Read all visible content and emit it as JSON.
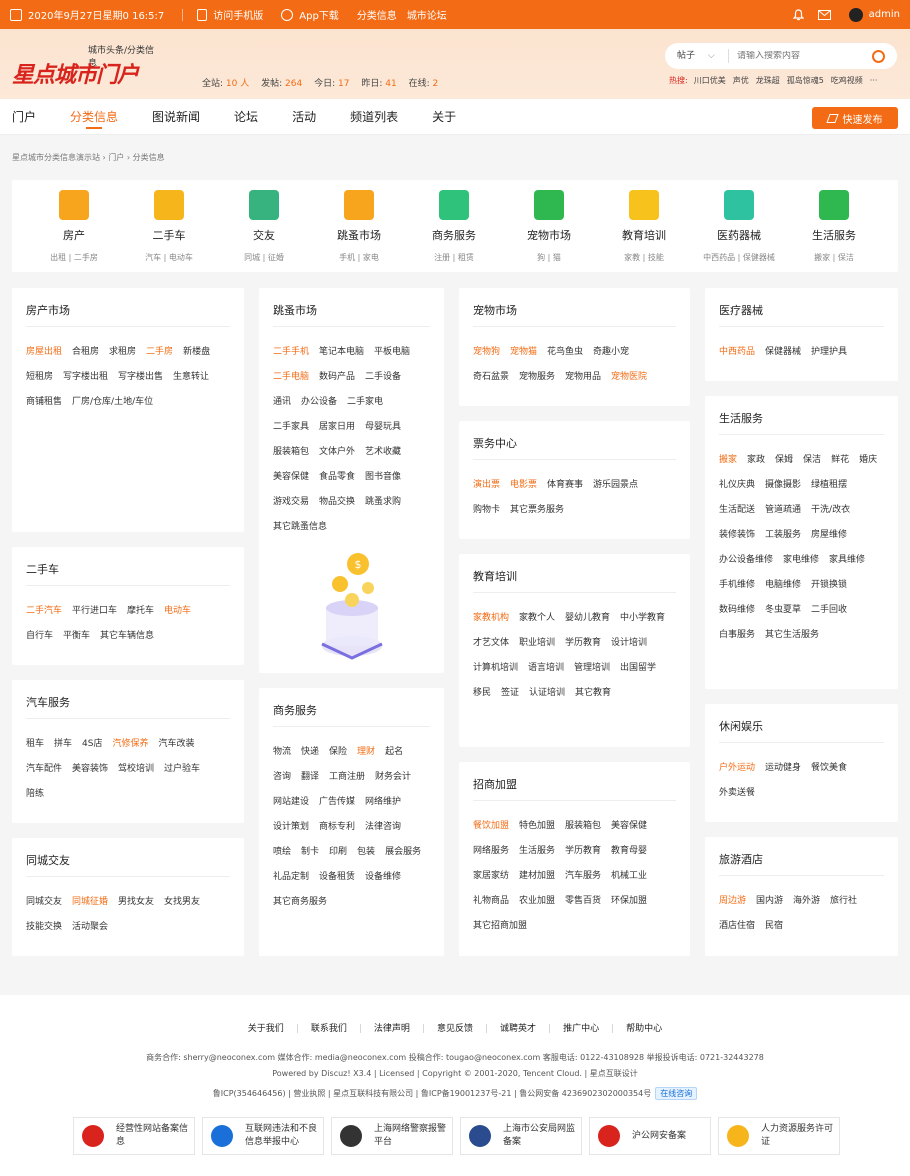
{
  "topbar": {
    "datetime": "2020年9月27日星期0 16:5:7",
    "mobile": "访问手机版",
    "app": "App下载",
    "links": [
      "分类信息",
      "城市论坛"
    ],
    "user": "admin"
  },
  "header": {
    "logo_main": "星点城市门户",
    "logo_sub1": "城市头条/分类信息",
    "stats": [
      {
        "label": "全站:",
        "value": "10 人"
      },
      {
        "label": "发帖:",
        "value": "264"
      },
      {
        "label": "今日:",
        "value": "17"
      },
      {
        "label": "昨日:",
        "value": "41"
      },
      {
        "label": "在线:",
        "value": "2"
      }
    ],
    "search_select": "帖子",
    "search_placeholder": "请输入搜索内容",
    "hot_label": "热搜:",
    "hot_items": [
      "川口优美",
      "声优",
      "龙珠超",
      "孤岛惊魂5",
      "吃鸡视频",
      "···"
    ]
  },
  "nav": {
    "items": [
      "门户",
      "分类信息",
      "图说新闻",
      "论坛",
      "活动",
      "频道列表",
      "关于"
    ],
    "active_index": 1,
    "publish": "快速发布"
  },
  "breadcrumb": "星点城市分类信息演示站 › 门户 › 分类信息",
  "categories": [
    {
      "name": "房产",
      "sub": "出租 | 二手房",
      "color": "#f7a51c"
    },
    {
      "name": "二手车",
      "sub": "汽车 | 电动车",
      "color": "#f7b51c"
    },
    {
      "name": "交友",
      "sub": "同城 | 征婚",
      "color": "#36b37e"
    },
    {
      "name": "跳蚤市场",
      "sub": "手机 | 家电",
      "color": "#f7a51c"
    },
    {
      "name": "商务服务",
      "sub": "注册 | 租赁",
      "color": "#2fc27a"
    },
    {
      "name": "宠物市场",
      "sub": "狗 | 猫",
      "color": "#2fb84f"
    },
    {
      "name": "教育培训",
      "sub": "家教 | 技能",
      "color": "#f7c21c"
    },
    {
      "name": "医药器械",
      "sub": "中西药品 | 保健器械",
      "color": "#2fc2a0"
    },
    {
      "name": "生活服务",
      "sub": "搬家 | 保洁",
      "color": "#2fb84f"
    }
  ],
  "panels": {
    "house": {
      "title": "房产市场",
      "items": [
        "房屋出租",
        "合租房",
        "求租房",
        "二手房",
        "新楼盘",
        "短租房",
        "写字楼出租",
        "写字楼出售",
        "生意转让",
        "商铺租售",
        "厂房/仓库/土地/车位"
      ],
      "hot": [
        0,
        3
      ]
    },
    "car": {
      "title": "二手车",
      "items": [
        "二手汽车",
        "平行进口车",
        "摩托车",
        "电动车",
        "自行车",
        "平衡车",
        "其它车辆信息"
      ],
      "hot": [
        0,
        3
      ]
    },
    "carsvc": {
      "title": "汽车服务",
      "items": [
        "租车",
        "拼车",
        "4S店",
        "汽修保养",
        "汽车改装",
        "汽车配件",
        "美容装饰",
        "驾校培训",
        "过户验车",
        "陪练"
      ],
      "hot": [
        3
      ]
    },
    "dating": {
      "title": "同城交友",
      "items": [
        "同城交友",
        "同城征婚",
        "男找女友",
        "女找男友",
        "技能交换",
        "活动聚会"
      ],
      "hot": [
        1
      ]
    },
    "flea": {
      "title": "跳蚤市场",
      "items": [
        "二手手机",
        "笔记本电脑",
        "平板电脑",
        "二手电脑",
        "数码产品",
        "二手设备",
        "通讯",
        "办公设备",
        "二手家电",
        "二手家具",
        "居家日用",
        "母婴玩具",
        "服装箱包",
        "文体户外",
        "艺术收藏",
        "美容保健",
        "食品零食",
        "图书音像",
        "游戏交易",
        "物品交换",
        "跳蚤求购",
        "其它跳蚤信息"
      ],
      "hot": [
        0,
        3
      ]
    },
    "biz": {
      "title": "商务服务",
      "items": [
        "物流",
        "快递",
        "保险",
        "理财",
        "起名",
        "咨询",
        "翻译",
        "工商注册",
        "财务会计",
        "网站建设",
        "广告传媒",
        "网络维护",
        "设计策划",
        "商标专利",
        "法律咨询",
        "喷绘",
        "制卡",
        "印刷",
        "包装",
        "展会服务",
        "礼品定制",
        "设备租赁",
        "设备维修",
        "其它商务服务"
      ],
      "hot": [
        3
      ]
    },
    "pet": {
      "title": "宠物市场",
      "items": [
        "宠物狗",
        "宠物猫",
        "花鸟鱼虫",
        "奇趣小宠",
        "奇石盆景",
        "宠物服务",
        "宠物用品",
        "宠物医院"
      ],
      "hot": [
        0,
        1,
        7
      ]
    },
    "ticket": {
      "title": "票务中心",
      "items": [
        "演出票",
        "电影票",
        "体育赛事",
        "游乐园景点",
        "购物卡",
        "其它票务服务"
      ],
      "hot": [
        0,
        1
      ]
    },
    "edu": {
      "title": "教育培训",
      "items": [
        "家教机构",
        "家教个人",
        "婴幼儿教育",
        "中小学教育",
        "才艺文体",
        "职业培训",
        "学历教育",
        "设计培训",
        "计算机培训",
        "语言培训",
        "管理培训",
        "出国留学",
        "移民",
        "签证",
        "认证培训",
        "其它教育"
      ],
      "hot": [
        0
      ]
    },
    "franchise": {
      "title": "招商加盟",
      "items": [
        "餐饮加盟",
        "特色加盟",
        "服装箱包",
        "美容保健",
        "网络服务",
        "生活服务",
        "学历教育",
        "教育母婴",
        "家居家纺",
        "建材加盟",
        "汽车服务",
        "机械工业",
        "礼物商品",
        "农业加盟",
        "零售百货",
        "环保加盟",
        "其它招商加盟"
      ],
      "hot": [
        0
      ]
    },
    "medical": {
      "title": "医疗器械",
      "items": [
        "中西药品",
        "保健器械",
        "护理护具"
      ],
      "hot": [
        0
      ]
    },
    "life": {
      "title": "生活服务",
      "items": [
        "搬家",
        "家政",
        "保姆",
        "保洁",
        "鲜花",
        "婚庆",
        "礼仪庆典",
        "摄像摄影",
        "绿植租摆",
        "生活配送",
        "管道疏通",
        "干洗/改衣",
        "装修装饰",
        "工装服务",
        "房屋维修",
        "办公设备维修",
        "家电维修",
        "家具维修",
        "手机维修",
        "电脑维修",
        "开锁换锁",
        "数码维修",
        "冬虫夏草",
        "二手回收",
        "白事服务",
        "其它生活服务"
      ],
      "hot": [
        0
      ]
    },
    "leisure": {
      "title": "休闲娱乐",
      "items": [
        "户外运动",
        "运动健身",
        "餐饮美食",
        "外卖送餐"
      ],
      "hot": [
        0
      ]
    },
    "travel": {
      "title": "旅游酒店",
      "items": [
        "周边游",
        "国内游",
        "海外游",
        "旅行社",
        "酒店住宿",
        "民宿"
      ],
      "hot": [
        0
      ]
    }
  },
  "footer": {
    "links": [
      "关于我们",
      "联系我们",
      "法律声明",
      "意见反馈",
      "诚聘英才",
      "推广中心",
      "帮助中心"
    ],
    "contact": "商务合作: sherry@neoconex.com   媒体合作: media@neoconex.com   投稿合作: tougao@neoconex.com   客服电话: 0122-43108928   举报投诉电话: 0721-32443278",
    "powered": "Powered by Discuz! X3.4  |  Licensed  |  Copyright © 2001-2020, Tencent Cloud.  |  星点互联设计",
    "icp": "鲁ICP(354646456)  |  营业执照  |  星点互联科技有限公司  |  鲁ICP备19001237号-21  |  鲁公网安备 4236902302000354号",
    "online": "在线咨询",
    "badges": [
      {
        "text": "经营性网站备案信息",
        "color": "#d8241c"
      },
      {
        "text": "互联网违法和不良信息举报中心",
        "color": "#1a6fd8"
      },
      {
        "text": "上海网络警察报警平台",
        "color": "#333"
      },
      {
        "text": "上海市公安局网监备案",
        "color": "#2a4b8d"
      },
      {
        "text": "沪公网安备案",
        "color": "#d8241c"
      },
      {
        "text": "人力资源服务许可证",
        "color": "#f7b51c"
      }
    ]
  },
  "colors": {
    "accent": "#f36c15",
    "hot": "#f36c15"
  }
}
